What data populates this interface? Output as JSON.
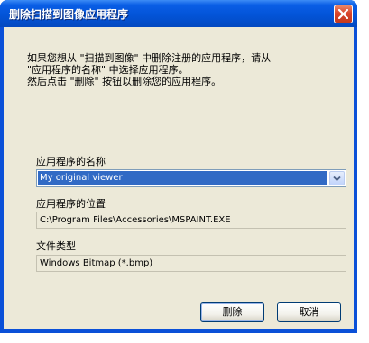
{
  "dialog": {
    "title": "删除扫描到图像应用程序",
    "instructions": [
      "如果您想从 \"扫描到图像\" 中删除注册的应用程序，请从",
      "\"应用程序的名称\" 中选择应用程序。",
      "然后点击 \"删除\" 按钮以删除您的应用程序。"
    ],
    "app_name_label": "应用程序的名称",
    "app_name_value": "My original viewer",
    "app_location_label": "应用程序的位置",
    "app_location_value": "C:\\Program Files\\Accessories\\MSPAINT.EXE",
    "file_type_label": "文件类型",
    "file_type_value": "Windows Bitmap (*.bmp)",
    "delete_button": "删除",
    "cancel_button": "取消"
  },
  "icons": {
    "close": "close-icon",
    "dropdown": "chevron-down-icon"
  },
  "colors": {
    "titlebar": "#0354d8",
    "close_button": "#d9442a",
    "dialog_background": "#ece9d8",
    "selection": "#316ac5"
  }
}
